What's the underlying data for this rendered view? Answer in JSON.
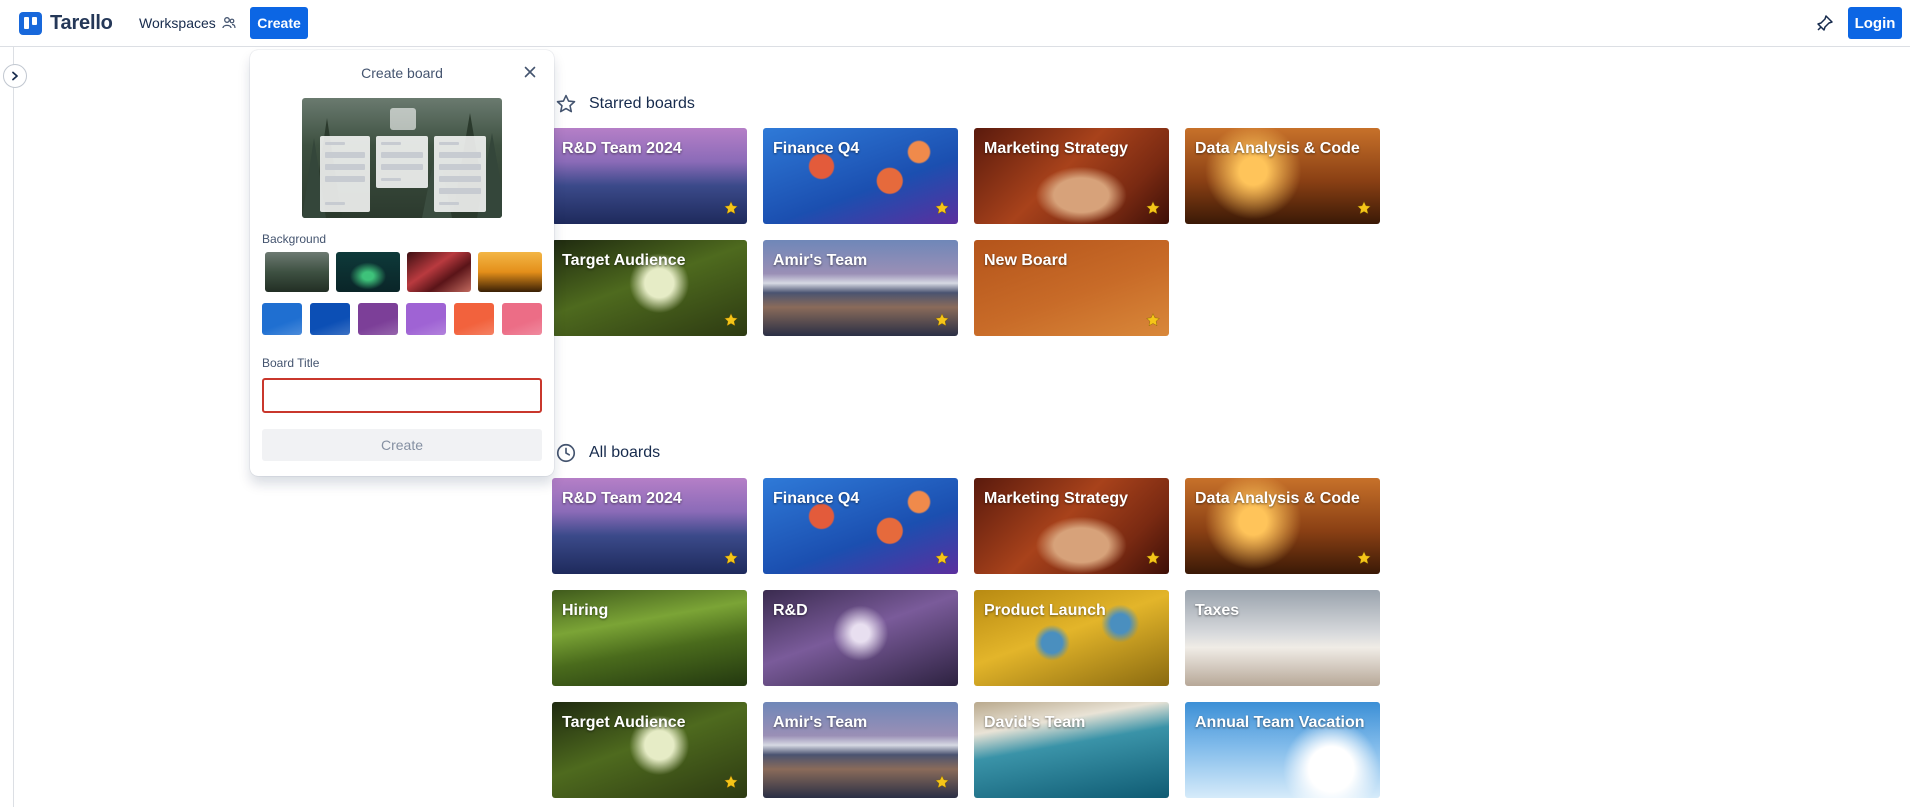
{
  "header": {
    "logo_text": "Tarello",
    "workspaces_label": "Workspaces",
    "create_label": "Create",
    "login_label": "Login"
  },
  "sections": {
    "starred_title": "Starred boards",
    "all_title": "All boards"
  },
  "starred_boards": [
    {
      "title": "R&D Team 2024",
      "starred": true,
      "bg": "mountains-purple"
    },
    {
      "title": "Finance Q4",
      "starred": true,
      "bg": "jellyfish"
    },
    {
      "title": "Marketing Strategy",
      "starred": true,
      "bg": "canyon"
    },
    {
      "title": "Data Analysis & Code",
      "starred": true,
      "bg": "sunset-grass"
    },
    {
      "title": "Target Audience",
      "starred": true,
      "bg": "plant"
    },
    {
      "title": "Amir's Team",
      "starred": true,
      "bg": "volcano"
    },
    {
      "title": "New Board",
      "starred": true,
      "bg": "orange-solid"
    }
  ],
  "all_boards": [
    {
      "title": "R&D Team 2024",
      "starred": true,
      "bg": "mountains-purple"
    },
    {
      "title": "Finance Q4",
      "starred": true,
      "bg": "jellyfish"
    },
    {
      "title": "Marketing Strategy",
      "starred": true,
      "bg": "canyon"
    },
    {
      "title": "Data Analysis & Code",
      "starred": true,
      "bg": "sunset-grass"
    },
    {
      "title": "Hiring",
      "starred": false,
      "bg": "green-hills"
    },
    {
      "title": "R&D",
      "starred": false,
      "bg": "lavender"
    },
    {
      "title": "Product Launch",
      "starred": false,
      "bg": "yellow-leaves"
    },
    {
      "title": "Taxes",
      "starred": false,
      "bg": "desk"
    },
    {
      "title": "Target Audience",
      "starred": true,
      "bg": "plant"
    },
    {
      "title": "Amir's Team",
      "starred": true,
      "bg": "volcano"
    },
    {
      "title": "David's Team",
      "starred": false,
      "bg": "ocean"
    },
    {
      "title": "Annual Team Vacation",
      "starred": false,
      "bg": "sky"
    }
  ],
  "create_board_popover": {
    "title": "Create board",
    "background_label": "Background",
    "board_title_label": "Board Title",
    "board_title_value": "",
    "create_label": "Create",
    "photo_backgrounds": [
      "forest",
      "aurora",
      "red-waves",
      "golden-sunset"
    ],
    "color_backgrounds": [
      "#1f6fd1",
      "#0c4fb5",
      "#7c3f98",
      "#9f63d4",
      "#f2623d",
      "#ec6d86"
    ]
  },
  "colors": {
    "brand": "#0c66e4",
    "star": "#f5c518",
    "input_error_border": "#c9372c"
  }
}
